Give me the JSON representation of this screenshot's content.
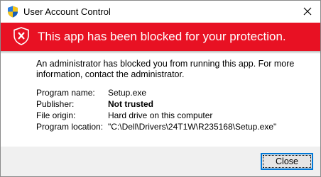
{
  "window": {
    "title": "User Account Control",
    "close_icon": "close-icon",
    "title_icon": "uac-shield-icon"
  },
  "banner": {
    "text": "This app has been blocked for your protection.",
    "icon": "blocked-shield-icon",
    "color": "#e81123"
  },
  "message": "An administrator has blocked you from running this app. For more information, contact the administrator.",
  "details": [
    {
      "label": "Program name:",
      "value": "Setup.exe",
      "bold": false
    },
    {
      "label": "Publisher:",
      "value": "Not trusted",
      "bold": true
    },
    {
      "label": "File origin:",
      "value": "Hard drive on this computer",
      "bold": false
    },
    {
      "label": "Program location:",
      "value": "\"C:\\Dell\\Drivers\\24T1W\\R235168\\Setup.exe\"",
      "bold": false
    }
  ],
  "footer": {
    "close_label": "Close",
    "accent": "#0078d7"
  }
}
